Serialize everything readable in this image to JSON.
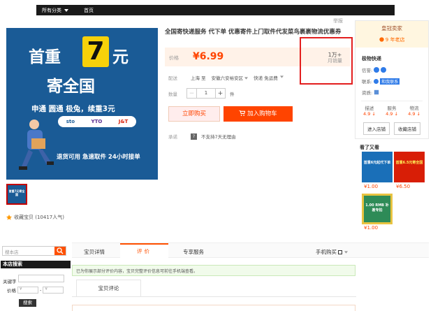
{
  "nav": {
    "all_categories": "所有分类",
    "home": "首页"
  },
  "report": "举报",
  "product": {
    "title": "全国寄快递服务 代下单 优惠寄件上门取件代发菜鸟裹裹物流优惠券",
    "price_label": "价格",
    "price": "¥6.99",
    "sales_count": "1万+",
    "sales_label": "月销量",
    "ship_label": "配送",
    "ship_from": "上海 至",
    "ship_to": "安徽六安裕安区",
    "ship_method": "快递 免运费",
    "qty_label": "数量",
    "qty_value": "1",
    "qty_minus": "−",
    "qty_plus": "+",
    "qty_unit": "件",
    "buy_now": "立即购买",
    "add_cart": "加入购物车",
    "promise_label": "承诺",
    "promise_text": "不支持7天无理由"
  },
  "main_image": {
    "line1": "首重",
    "big": "7",
    "yuan": "元",
    "line2": "寄全国",
    "line3": "申通 圆通 极兔，续重3元",
    "logos": [
      "sto",
      "YTO",
      "J&T"
    ],
    "line4": "退货可用 急速取件 24小时接单"
  },
  "thumb": {
    "text": "首重7元寄全国"
  },
  "favorite": "收藏宝贝 (10417人气)",
  "shop": {
    "badge": "皇冠卖家",
    "years": "9 年老店",
    "name": "极物快递",
    "credit_label": "信誉:",
    "contact_label": "联系:",
    "chat": "和我联系",
    "qual_label": "资质:",
    "scores": [
      {
        "label": "描述",
        "value": "4.9"
      },
      {
        "label": "服务",
        "value": "4.9"
      },
      {
        "label": "物流",
        "value": "4.9"
      }
    ],
    "enter": "进入店铺",
    "fav_shop": "收藏店铺"
  },
  "also_viewed": {
    "title": "看了又看",
    "items": [
      {
        "text": "首重6元起代下单",
        "price": "1.00",
        "color": "#1a6fb8"
      },
      {
        "text": "首重6.5元寄全国",
        "price": "6.50",
        "color": "#d81e06"
      },
      {
        "text": "1.00 RMB 补差专拍",
        "price": "1.00",
        "color": "#2e8b57"
      }
    ]
  },
  "sidebar": {
    "search_placeholder": "搜本店",
    "store_search": "本店搜索",
    "keyword": "关键字",
    "price": "价格",
    "min": "¥",
    "max": "¥",
    "search_btn": "搜索"
  },
  "tabs": {
    "detail": "宝贝详情",
    "reviews": "评价",
    "service": "专享服务",
    "mobile": "手机购买"
  },
  "notice": "已为你展示部分评价内容，宝贝完整评价信息可前往手机端查看。",
  "review_tab": "宝贝评论"
}
